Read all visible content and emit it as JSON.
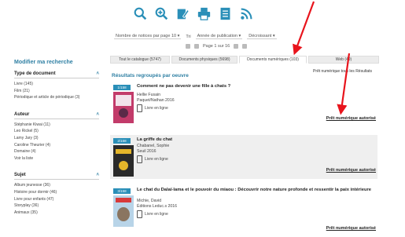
{
  "toolbar": {
    "icons": [
      "search-icon",
      "zoom-search-icon",
      "edit-icon",
      "print-icon",
      "document-icon",
      "rss-icon"
    ],
    "accent": "#2e7fa3"
  },
  "controls": {
    "per_page": "Nombre de notices par page",
    "per_page_value": "10",
    "sort_label": "Tri",
    "sort_value": "Année de publication",
    "order_value": "Décroissant"
  },
  "pager": {
    "text": "Page 1 sur 16"
  },
  "tabs": [
    {
      "label": "Tout le catalogue (5747)",
      "active": false
    },
    {
      "label": "Documents physiques (5698)",
      "active": false
    },
    {
      "label": "Documents numériques (103)",
      "active": true
    },
    {
      "label": "Web (49)",
      "active": false
    }
  ],
  "tab_link": "Prêt numérique tous les Résultats",
  "sidebar": {
    "title": "Modifier ma recherche",
    "facets": [
      {
        "head": "Type de document",
        "items": [
          "Livre (145)",
          "Film (21)",
          "Périodique et article de périodique (3)"
        ]
      },
      {
        "head": "Auteur",
        "items": [
          "Stéphanie Kiwai (11)",
          "Leo Rickel (5)",
          "Lamy Jary (3)",
          "Caroline Theurier (4)",
          "Domaine (4)",
          "Voir la liste"
        ]
      },
      {
        "head": "Sujet",
        "items": [
          "Album jeunesse (36)",
          "Histoire pour dormir (46)",
          "Livre pour enfants (47)",
          "Storyplay (36)",
          "Animaux (35)"
        ]
      }
    ]
  },
  "results_title": "Résultats regroupés par oeuvre",
  "results": [
    {
      "tag": "1/158",
      "title": "Comment ne pas devenir une fille à chats ?",
      "author": "Hellie Fusain",
      "publisher": "Paquet/Nathan 2016",
      "format": "Livre en ligne",
      "loan": "Prêt numérique autorisé",
      "cover_color": "#c23b6a"
    },
    {
      "tag": "2/158",
      "title": "La griffe du chat",
      "author": "Chabanel, Sophie",
      "publisher": "Seuil 2016",
      "format": "Livre en ligne",
      "loan": "Prêt numérique autorisé",
      "cover_color": "#2a2a2a"
    },
    {
      "tag": "3/158",
      "title": "Le chat du Dalaï-lama et le pouvoir du miaou : Découvrir notre nature profonde et ressentir la paix intérieure",
      "author": "Michie, David",
      "publisher": "Éditions Leduc.s 2016",
      "format": "Livre en ligne",
      "loan": "Prêt numérique autorisé",
      "cover_color": "#b8d4e8"
    }
  ]
}
